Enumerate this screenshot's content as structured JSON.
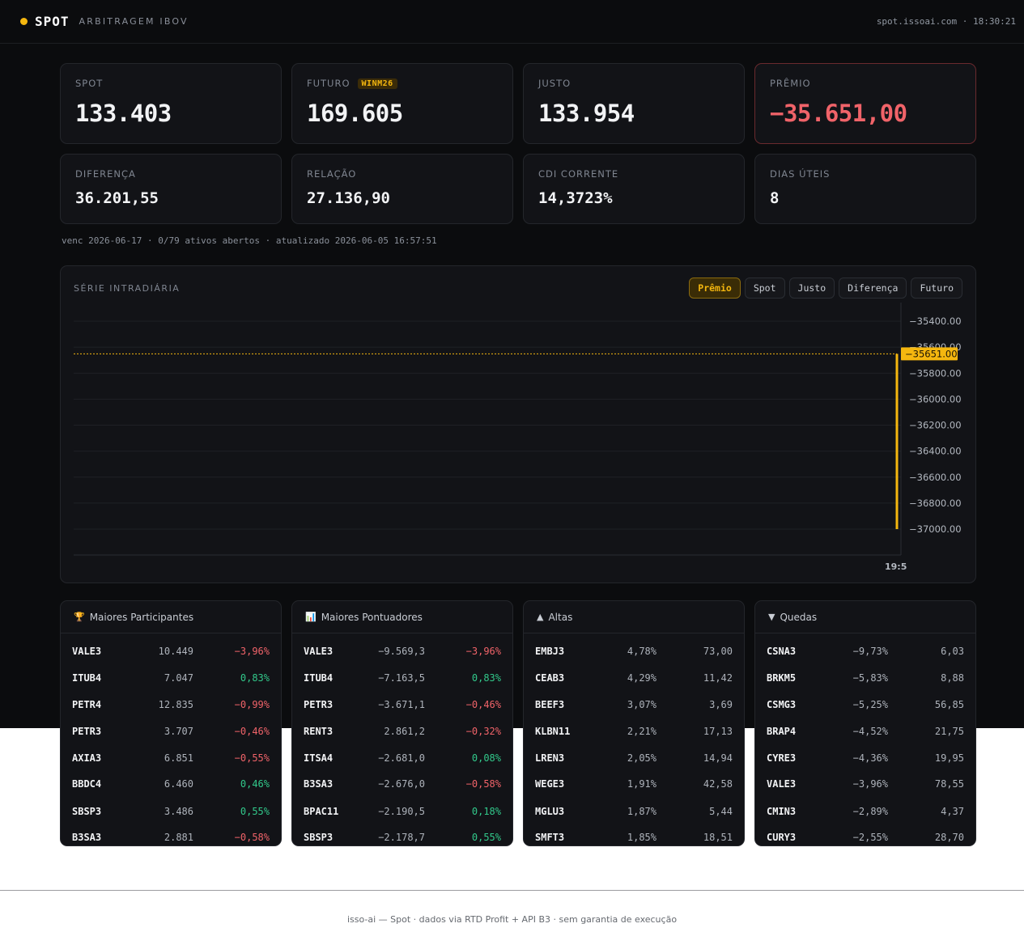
{
  "header": {
    "brand": "SPOT",
    "subtitle": "ARBITRAGEM IBOV",
    "right": "spot.issoai.com · 18:30:21"
  },
  "stats": [
    {
      "label": "SPOT",
      "value": "133.403"
    },
    {
      "label": "FUTURO",
      "badge": "WINM26",
      "value": "169.605"
    },
    {
      "label": "JUSTO",
      "value": "133.954"
    },
    {
      "label": "PRÊMIO",
      "value": "−35.651,00"
    },
    {
      "label": "DIFERENÇA",
      "value": "36.201,55"
    },
    {
      "label": "RELAÇÃO",
      "value": "27.136,90"
    },
    {
      "label": "CDI CORRENTE",
      "value": "14,3723%"
    },
    {
      "label": "DIAS ÚTEIS",
      "value": "8"
    }
  ],
  "meta_line": "venc 2026-06-17 · 0/79 ativos abertos · atualizado 2026-06-05 16:57:51",
  "chart": {
    "title": "SÉRIE INTRADIÁRIA",
    "tabs": [
      "Prêmio",
      "Spot",
      "Justo",
      "Diferença",
      "Futuro"
    ],
    "active_tab": "Prêmio",
    "y_ticks": [
      "−35400.00",
      "−35600.00",
      "−35800.00",
      "−36000.00",
      "−36200.00",
      "−36400.00",
      "−36600.00",
      "−36800.00",
      "−37000.00"
    ],
    "current_label": "−35651.00",
    "x_tick": "19:5",
    "accent": "#f5b70f"
  },
  "chart_data": {
    "type": "line",
    "series": [
      {
        "values": [
          -37000,
          -35651
        ]
      }
    ],
    "current_value": -35651,
    "ylim": [
      -37000,
      -35400
    ],
    "y_ticks": [
      -35400,
      -35600,
      -35800,
      -36000,
      -36200,
      -36400,
      -36600,
      -36800,
      -37000
    ],
    "x_ticks": [
      "19:5"
    ],
    "grid": true
  },
  "lists": [
    {
      "icon": "🏆",
      "title": "Maiores Participantes",
      "rows": [
        {
          "sym": "VALE3",
          "v": "10.449",
          "pct": "−3,96%",
          "dir": "neg"
        },
        {
          "sym": "ITUB4",
          "v": "7.047",
          "pct": "0,83%",
          "dir": "pos"
        },
        {
          "sym": "PETR4",
          "v": "12.835",
          "pct": "−0,99%",
          "dir": "neg"
        },
        {
          "sym": "PETR3",
          "v": "3.707",
          "pct": "−0,46%",
          "dir": "neg"
        },
        {
          "sym": "AXIA3",
          "v": "6.851",
          "pct": "−0,55%",
          "dir": "neg"
        },
        {
          "sym": "BBDC4",
          "v": "6.460",
          "pct": "0,46%",
          "dir": "pos"
        },
        {
          "sym": "SBSP3",
          "v": "3.486",
          "pct": "0,55%",
          "dir": "pos"
        },
        {
          "sym": "B3SA3",
          "v": "2.881",
          "pct": "−0,58%",
          "dir": "neg"
        }
      ]
    },
    {
      "icon": "📊",
      "title": "Maiores Pontuadores",
      "rows": [
        {
          "sym": "VALE3",
          "v": "−9.569,3",
          "vdir": "neg",
          "pct": "−3,96%",
          "dir": "neg"
        },
        {
          "sym": "ITUB4",
          "v": "−7.163,5",
          "vdir": "neg",
          "pct": "0,83%",
          "dir": "pos"
        },
        {
          "sym": "PETR3",
          "v": "−3.671,1",
          "vdir": "neg",
          "pct": "−0,46%",
          "dir": "neg"
        },
        {
          "sym": "RENT3",
          "v": "2.861,2",
          "vdir": "pos",
          "pct": "−0,32%",
          "dir": "neg"
        },
        {
          "sym": "ITSA4",
          "v": "−2.681,0",
          "vdir": "neg",
          "pct": "0,08%",
          "dir": "pos"
        },
        {
          "sym": "B3SA3",
          "v": "−2.676,0",
          "vdir": "neg",
          "pct": "−0,58%",
          "dir": "neg"
        },
        {
          "sym": "BPAC11",
          "v": "−2.190,5",
          "vdir": "neg",
          "pct": "0,18%",
          "dir": "pos"
        },
        {
          "sym": "SBSP3",
          "v": "−2.178,7",
          "vdir": "neg",
          "pct": "0,55%",
          "dir": "pos"
        }
      ]
    },
    {
      "icon": "▲",
      "title": "Altas",
      "rows": [
        {
          "sym": "EMBJ3",
          "pct": "4,78%",
          "dir": "pos",
          "v": "73,00"
        },
        {
          "sym": "CEAB3",
          "pct": "4,29%",
          "dir": "pos",
          "v": "11,42"
        },
        {
          "sym": "BEEF3",
          "pct": "3,07%",
          "dir": "pos",
          "v": "3,69"
        },
        {
          "sym": "KLBN11",
          "pct": "2,21%",
          "dir": "pos",
          "v": "17,13"
        },
        {
          "sym": "LREN3",
          "pct": "2,05%",
          "dir": "pos",
          "v": "14,94"
        },
        {
          "sym": "WEGE3",
          "pct": "1,91%",
          "dir": "pos",
          "v": "42,58"
        },
        {
          "sym": "MGLU3",
          "pct": "1,87%",
          "dir": "pos",
          "v": "5,44"
        },
        {
          "sym": "SMFT3",
          "pct": "1,85%",
          "dir": "pos",
          "v": "18,51"
        }
      ]
    },
    {
      "icon": "▼",
      "title": "Quedas",
      "rows": [
        {
          "sym": "CSNA3",
          "pct": "−9,73%",
          "dir": "neg",
          "v": "6,03"
        },
        {
          "sym": "BRKM5",
          "pct": "−5,83%",
          "dir": "neg",
          "v": "8,88"
        },
        {
          "sym": "CSMG3",
          "pct": "−5,25%",
          "dir": "neg",
          "v": "56,85"
        },
        {
          "sym": "BRAP4",
          "pct": "−4,52%",
          "dir": "neg",
          "v": "21,75"
        },
        {
          "sym": "CYRE3",
          "pct": "−4,36%",
          "dir": "neg",
          "v": "19,95"
        },
        {
          "sym": "VALE3",
          "pct": "−3,96%",
          "dir": "neg",
          "v": "78,55"
        },
        {
          "sym": "CMIN3",
          "pct": "−2,89%",
          "dir": "neg",
          "v": "4,37"
        },
        {
          "sym": "CURY3",
          "pct": "−2,55%",
          "dir": "neg",
          "v": "28,70"
        }
      ]
    }
  ],
  "footer": "isso-ai — Spot · dados via RTD Profit + API B3 · sem garantia de execução"
}
